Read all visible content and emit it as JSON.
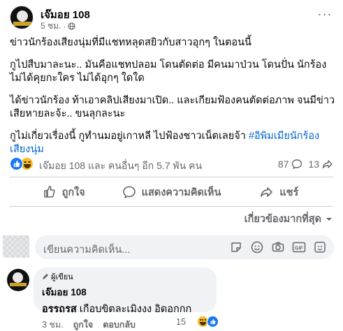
{
  "post": {
    "author": "เจ๊มอย 108",
    "time": "5 ชม.",
    "separator": "·",
    "more": "···",
    "paragraphs": [
      "ข่าวนักร้องเสียงนุ่มที่มีแชทหลุดสยิวกับสาวอุกๆ ในตอนนี้",
      "กูไปสืบมาละนะ.. มันคือแชทปลอม โดนตัดต่อ มีคนมาป่วน โดนปั่น นักร้องไม่ได้คุยกะใคร ไม่ได้อุกๆ ใดใด",
      "ได้ข่าวนักร้อง ท้าเอาคลิปเสียงมาเปิด.. และเกียมฟ้องคนตัดต่อภาพ จนมีข่าวเสียหายละจ้ะ.. ขนลุกละนะ"
    ],
    "last_paragraph_text": "กูไม่เกี่ยวเรื่องนี้ กูทำนมอยู่เกาหลี ไปฟ้องชาวเน็ตเลยจ้า ",
    "hashtag": "#อิพิมเมียนักร้องเสียงนุ่ม"
  },
  "stats": {
    "reaction_text": "เจ๊มอย 108 และ คนอื่นๆ อีก 5.7 พัน คน",
    "comments": "87",
    "shares": "13"
  },
  "actions": {
    "like": "ถูกใจ",
    "comment": "แสดงความคิดเห็น",
    "share": "แชร์"
  },
  "sort": {
    "label": "เกี่ยวข้องมากที่สุด"
  },
  "composer": {
    "placeholder": "เขียนความคิดเห็น..."
  },
  "comment": {
    "badge": "ผู้เขียน",
    "author": "เจ๊มอย 108",
    "mention": "อรรถรส",
    "text": " เกือบขิตละเมิงงง อิดอกกก",
    "time": "3 ชม.",
    "like": "ถูกใจ",
    "reply": "ตอบกลับ",
    "reaction_count": "15"
  },
  "colors": {
    "primary_blue": "#1877f2",
    "hashtag_blue": "#0064d1",
    "secondary_text": "#65676b",
    "bubble_bg": "#f0f2f5"
  }
}
